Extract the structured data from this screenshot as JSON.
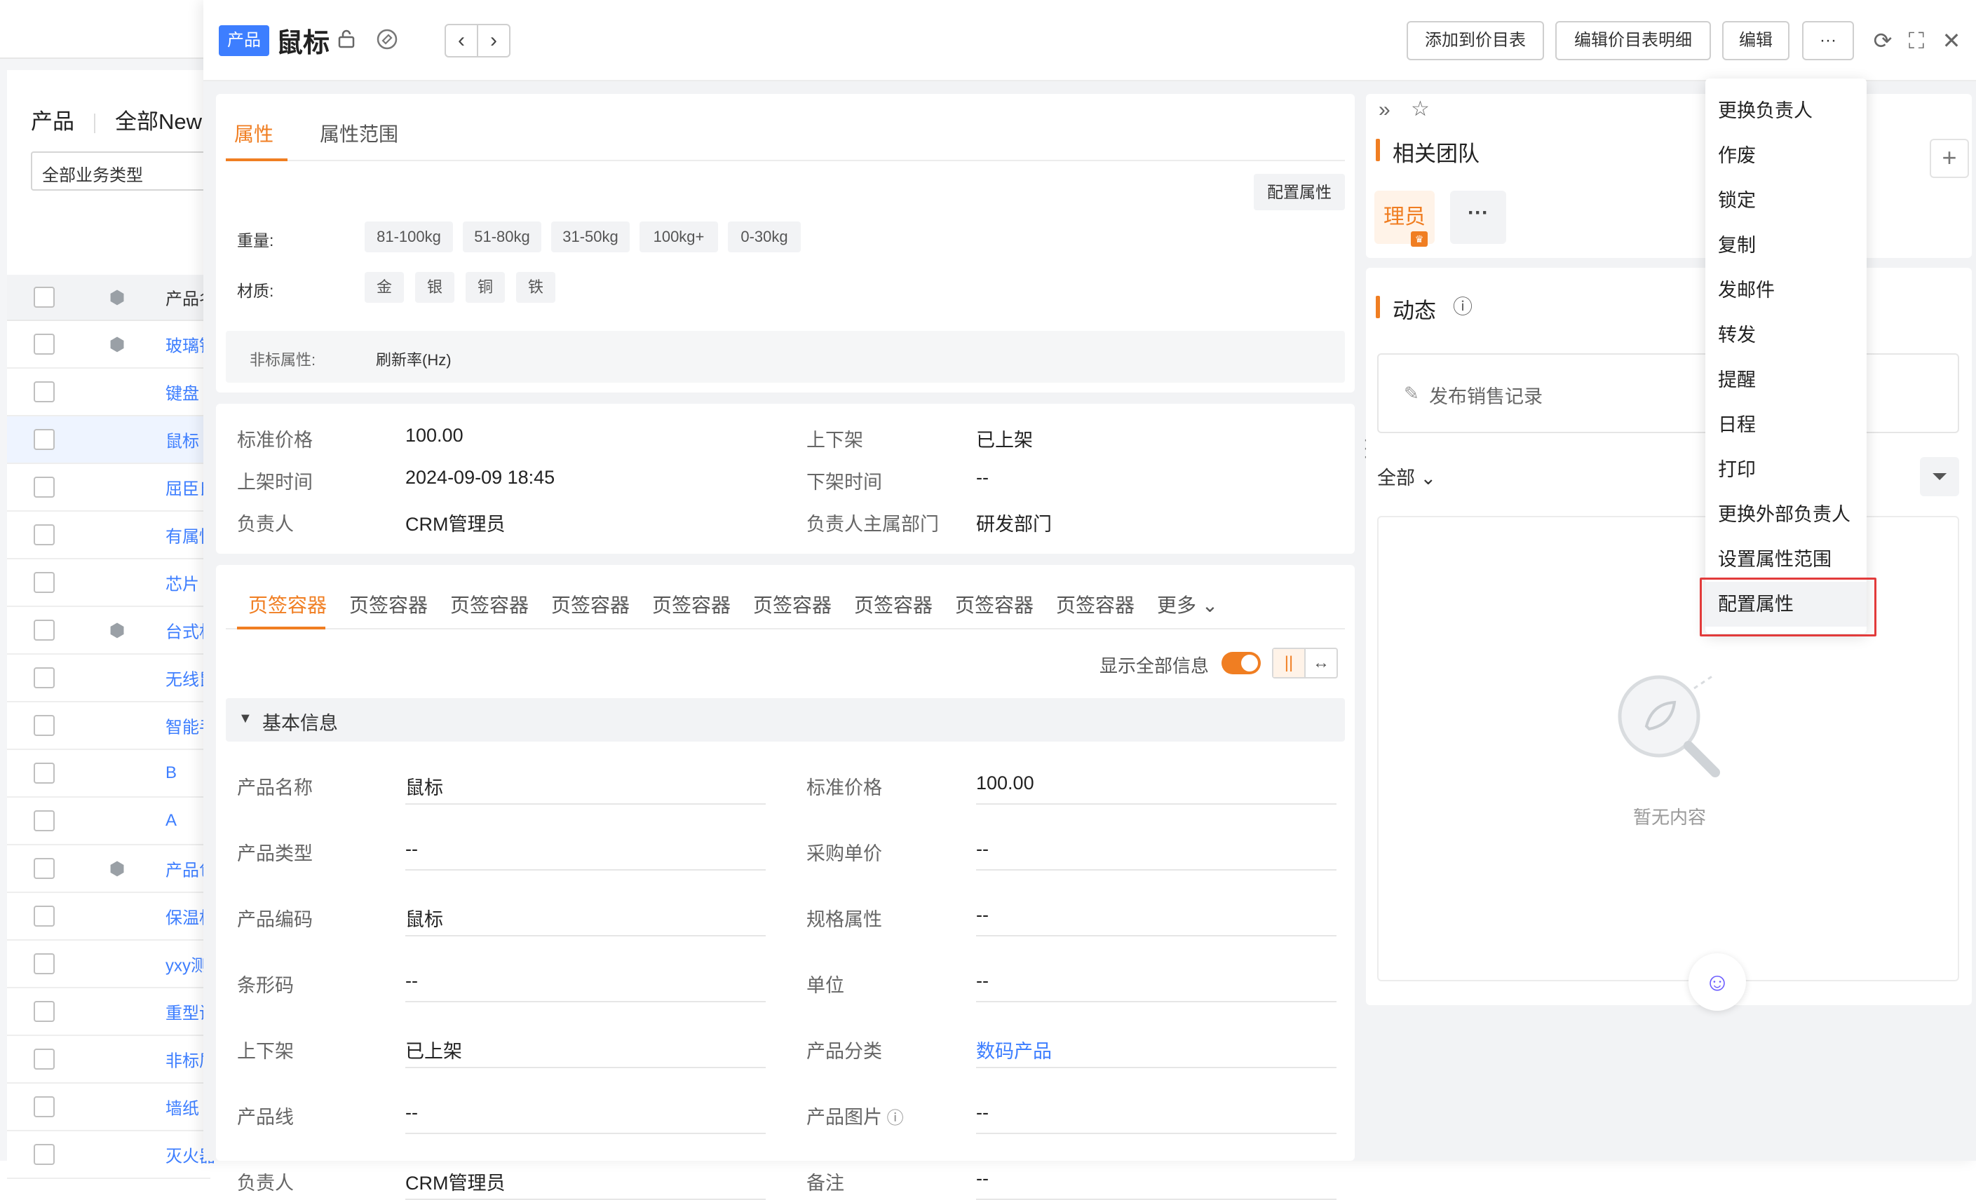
{
  "background": {
    "tabs": [
      "产品",
      "全部New"
    ],
    "business_type": "全部业务类型",
    "table_header": "产品名称",
    "rows": [
      {
        "name": "玻璃钢",
        "cube": true
      },
      {
        "name": "键盘",
        "cube": false
      },
      {
        "name": "鼠标",
        "cube": false,
        "selected": true
      },
      {
        "name": "屈臣氏",
        "cube": false
      },
      {
        "name": "有属性",
        "cube": false
      },
      {
        "name": "芯片",
        "cube": false
      },
      {
        "name": "台式机",
        "cube": true
      },
      {
        "name": "无线鼠标",
        "cube": false
      },
      {
        "name": "智能手表",
        "cube": false
      },
      {
        "name": "B",
        "cube": false
      },
      {
        "name": "A",
        "cube": false
      },
      {
        "name": "产品包",
        "cube": true
      },
      {
        "name": "保温杯",
        "cube": false
      },
      {
        "name": "yxy测试",
        "cube": false
      },
      {
        "name": "重型设备",
        "cube": false
      },
      {
        "name": "非标属性",
        "cube": false
      },
      {
        "name": "墙纸",
        "cube": false
      },
      {
        "name": "灭火器",
        "cube": false
      }
    ]
  },
  "header": {
    "badge": "产品",
    "title": "鼠标",
    "buttons": {
      "add_to_pricebook": "添加到价目表",
      "edit_pricebook_detail": "编辑价目表明细",
      "edit": "编辑",
      "more": "···"
    }
  },
  "attributes_card": {
    "tabs": [
      "属性",
      "属性范围"
    ],
    "config_button": "配置属性",
    "weight_label": "重量:",
    "weight_options": [
      "81-100kg",
      "51-80kg",
      "31-50kg",
      "100kg+",
      "0-30kg"
    ],
    "material_label": "材质:",
    "material_options": [
      "金",
      "银",
      "铜",
      "铁"
    ],
    "nonstandard_label": "非标属性:",
    "nonstandard_value": "刷新率(Hz)"
  },
  "summary": {
    "standard_price_label": "标准价格",
    "standard_price": "100.00",
    "shelf_label": "上下架",
    "shelf": "已上架",
    "on_time_label": "上架时间",
    "on_time": "2024-09-09 18:45",
    "off_time_label": "下架时间",
    "off_time": "--",
    "owner_label": "负责人",
    "owner": "CRM管理员",
    "dept_label": "负责人主属部门",
    "dept": "研发部门"
  },
  "page_tabs": {
    "tabs": [
      "页签容器",
      "页签容器",
      "页签容器",
      "页签容器",
      "页签容器",
      "页签容器",
      "页签容器",
      "页签容器",
      "页签容器"
    ],
    "more": "更多",
    "show_all": "显示全部信息",
    "section": "基本信息"
  },
  "fields": {
    "left": [
      {
        "label": "产品名称",
        "value": "鼠标"
      },
      {
        "label": "产品类型",
        "value": "--"
      },
      {
        "label": "产品编码",
        "value": "鼠标"
      },
      {
        "label": "条形码",
        "value": "--"
      },
      {
        "label": "上下架",
        "value": "已上架"
      },
      {
        "label": "产品线",
        "value": "--"
      },
      {
        "label": "负责人",
        "value": "CRM管理员"
      }
    ],
    "right": [
      {
        "label": "标准价格",
        "value": "100.00"
      },
      {
        "label": "采购单价",
        "value": "--"
      },
      {
        "label": "规格属性",
        "value": "--"
      },
      {
        "label": "单位",
        "value": "--"
      },
      {
        "label": "产品分类",
        "value": "数码产品",
        "link": true
      },
      {
        "label": "产品图片",
        "value": "--",
        "help": true
      },
      {
        "label": "备注",
        "value": "--"
      }
    ]
  },
  "team": {
    "title": "相关团队",
    "member": "理员"
  },
  "activity": {
    "title": "动态",
    "post_placeholder": "发布销售记录",
    "filter": "全部",
    "empty": "暂无内容"
  },
  "menu": {
    "items": [
      "更换负责人",
      "作废",
      "锁定",
      "复制",
      "发邮件",
      "转发",
      "提醒",
      "日程",
      "打印",
      "更换外部负责人",
      "设置属性范围",
      "配置属性"
    ],
    "highlighted": "配置属性"
  },
  "colors": {
    "accent": "#f07e22",
    "link": "#3d7eff",
    "highlight_frame": "#e23b3b"
  }
}
